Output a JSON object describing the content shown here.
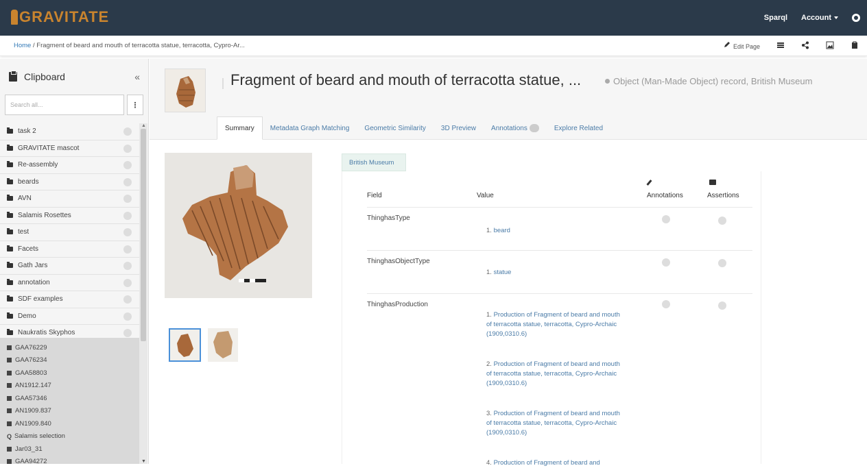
{
  "topbar": {
    "logo_text": "GRAVITATE",
    "sparql": "Sparql",
    "account": "Account",
    "colors": {
      "bar": "#2b3a4a",
      "logo": "#c9842e",
      "link": "#4a7ba7"
    }
  },
  "breadcrumb": {
    "home": "Home",
    "separator": "/",
    "current": "Fragment of beard and mouth of terracotta statue, terracotta, Cypro-Ar...",
    "edit_page": "Edit Page"
  },
  "sidebar": {
    "title": "Clipboard",
    "collapse": "«",
    "search_placeholder": "Search all...",
    "kebab": "⋮",
    "folders": [
      {
        "label": "task 2"
      },
      {
        "label": "GRAVITATE mascot"
      },
      {
        "label": "Re-assembly"
      },
      {
        "label": "beards"
      },
      {
        "label": "AVN"
      },
      {
        "label": "Salamis Rosettes"
      },
      {
        "label": "test"
      },
      {
        "label": "Facets"
      },
      {
        "label": "Gath Jars"
      },
      {
        "label": "annotation"
      },
      {
        "label": "SDF examples"
      },
      {
        "label": "Demo"
      },
      {
        "label": "Naukratis Skyphos"
      }
    ],
    "items": [
      {
        "label": "GAA76229",
        "icon": "square"
      },
      {
        "label": "GAA76234",
        "icon": "square"
      },
      {
        "label": "GAA58803",
        "icon": "square"
      },
      {
        "label": "AN1912.147",
        "icon": "square"
      },
      {
        "label": "GAA57346",
        "icon": "square"
      },
      {
        "label": "AN1909.837",
        "icon": "square"
      },
      {
        "label": "AN1909.840",
        "icon": "square"
      },
      {
        "label": "Salamis selection",
        "icon": "search"
      },
      {
        "label": "Jar03_31",
        "icon": "square"
      },
      {
        "label": "GAA94272",
        "icon": "square"
      }
    ]
  },
  "header": {
    "title": "Fragment of beard and mouth of terracotta statue, ...",
    "subtitle": "Object (Man-Made Object) record, British Museum",
    "tabs": [
      {
        "label": "Summary",
        "active": true
      },
      {
        "label": "Metadata Graph Matching"
      },
      {
        "label": "Geometric Similarity"
      },
      {
        "label": "3D Preview"
      },
      {
        "label": "Annotations",
        "badge": true
      },
      {
        "label": "Explore Related"
      }
    ]
  },
  "main": {
    "source_tab": "British Museum",
    "columns": {
      "field": "Field",
      "value": "Value",
      "annotations": "Annotations",
      "assertions": "Assertions"
    },
    "rows": [
      {
        "field": "ThinghasType",
        "values": [
          {
            "n": "1.",
            "text": "beard"
          }
        ]
      },
      {
        "field": "ThinghasObjectType",
        "values": [
          {
            "n": "1.",
            "text": "statue"
          }
        ]
      },
      {
        "field": "ThinghasProduction",
        "values": [
          {
            "n": "1.",
            "text": "Production of Fragment of beard and mouth of terracotta statue, terracotta, Cypro-Archaic (1909,0310.6)"
          },
          {
            "n": "2.",
            "text": "Production of Fragment of beard and mouth of terracotta statue, terracotta, Cypro-Archaic (1909,0310.6)"
          },
          {
            "n": "3.",
            "text": "Production of Fragment of beard and mouth of terracotta statue, terracotta, Cypro-Archaic (1909,0310.6)"
          },
          {
            "n": "4.",
            "text": "Production of Fragment of beard and"
          }
        ]
      }
    ]
  }
}
